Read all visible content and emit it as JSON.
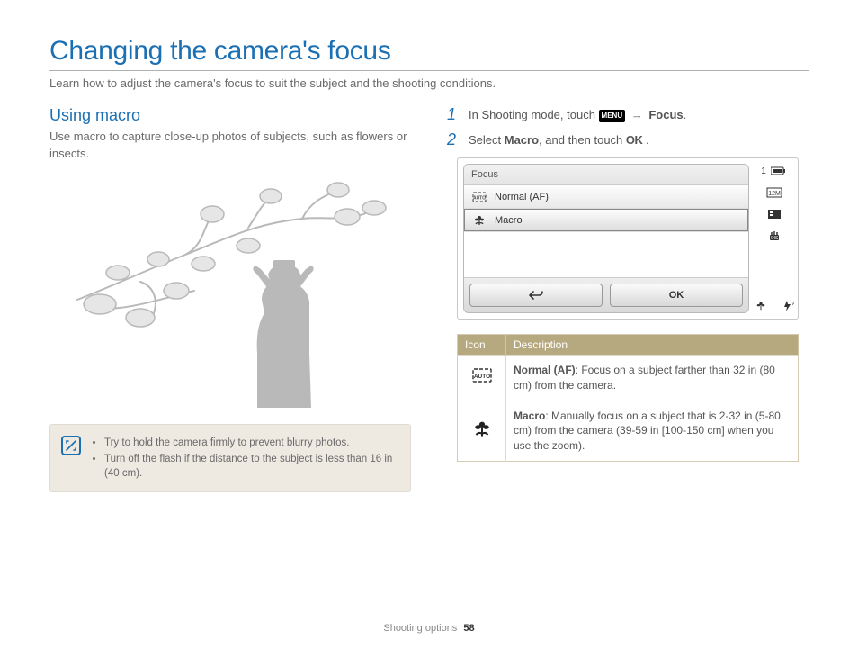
{
  "title": "Changing the camera's focus",
  "subtitle": "Learn how to adjust the camera's focus to suit the subject and the shooting conditions.",
  "left": {
    "heading": "Using macro",
    "body": "Use macro to capture close-up photos of subjects, such as flowers or insects.",
    "tips": [
      "Try to hold the camera firmly to prevent blurry photos.",
      "Turn off the flash if the distance to the subject is less than 16 in (40 cm)."
    ]
  },
  "steps": {
    "s1_num": "1",
    "s1_a": "In Shooting mode, touch ",
    "s1_menu": "MENU",
    "s1_arrow": "→",
    "s1_focus": "Focus",
    "s1_end": ".",
    "s2_num": "2",
    "s2_a": "Select ",
    "s2_macro": "Macro",
    "s2_b": ", and then touch ",
    "s2_ok": "OK",
    "s2_end": " ."
  },
  "screen": {
    "title": "Focus",
    "rows": {
      "normal_label": "Normal (AF)",
      "macro_label": "Macro"
    },
    "ok_label": "OK",
    "counter": "1"
  },
  "table": {
    "h_icon": "Icon",
    "h_desc": "Description",
    "normal_name": "Normal (AF)",
    "normal_desc": ": Focus on a subject farther than 32 in (80 cm) from the camera.",
    "macro_name": "Macro",
    "macro_desc": ": Manually focus on a subject that is 2-32 in (5-80 cm) from the camera (39-59 in [100-150 cm] when you use the zoom)."
  },
  "footer": {
    "section": "Shooting options",
    "page": "58"
  }
}
